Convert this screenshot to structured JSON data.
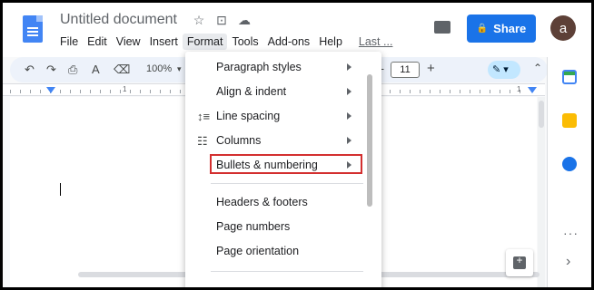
{
  "header": {
    "title": "Untitled document",
    "title_icons": [
      "☆",
      "⊡",
      "☁"
    ],
    "menu": [
      {
        "label": "File"
      },
      {
        "label": "Edit"
      },
      {
        "label": "View"
      },
      {
        "label": "Insert"
      },
      {
        "label": "Format"
      },
      {
        "label": "Tools"
      },
      {
        "label": "Add-ons"
      },
      {
        "label": "Help"
      },
      {
        "label": "Last ..."
      }
    ],
    "share_label": "Share",
    "lock_glyph": "🔒",
    "avatar_letter": "a"
  },
  "toolbar": {
    "undo": "↶",
    "redo": "↷",
    "print": "⎙",
    "spellcheck": "A",
    "paint_format": "⌫",
    "zoom": "100%",
    "zoom_caret": "▾",
    "font_minus": "−",
    "font_size": "11",
    "font_plus": "+",
    "edit_mode": "✎ ▾",
    "collapse": "⌃"
  },
  "ruler": {
    "numbers": [
      "1",
      "1"
    ]
  },
  "format_menu": {
    "items": [
      {
        "label": "Paragraph styles",
        "submenu": true,
        "icon": ""
      },
      {
        "label": "Align & indent",
        "submenu": true,
        "icon": ""
      },
      {
        "label": "Line spacing",
        "submenu": true,
        "icon": "↕≡"
      },
      {
        "label": "Columns",
        "submenu": true,
        "icon": "☷"
      },
      {
        "label": "Bullets & numbering",
        "submenu": true,
        "icon": ""
      },
      {
        "label": "Headers & footers",
        "submenu": false,
        "icon": ""
      },
      {
        "label": "Page numbers",
        "submenu": false,
        "icon": ""
      },
      {
        "label": "Page orientation",
        "submenu": false,
        "icon": ""
      }
    ],
    "highlight_color": "#d32f2f"
  },
  "side_panel": {
    "more": "···",
    "expand": "›"
  },
  "colors": {
    "accent": "#1a73e8",
    "avatar": "#5d4037"
  }
}
